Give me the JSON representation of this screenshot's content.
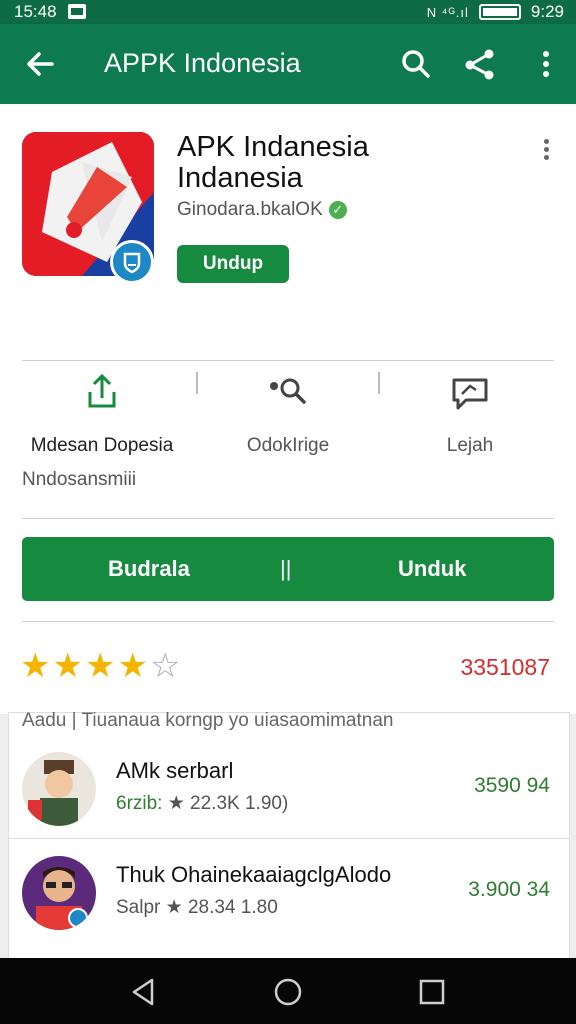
{
  "status_bar": {
    "left_time": "15:48",
    "right_time": "9:29",
    "signal_text": "N ⁴ᴳ.ıl"
  },
  "toolbar": {
    "title": "APPK Indonesia",
    "icons": [
      "back-arrow-icon",
      "search-icon",
      "share-icon",
      "more-vert-icon"
    ]
  },
  "app": {
    "name": "APK Indanesia Indanesia",
    "developer": "Ginodara.bkalOK",
    "verified_glyph": "✓",
    "install_small_label": "Undup"
  },
  "actions": [
    {
      "label": "Mdesan Dopesia",
      "icon": "share-upload-icon"
    },
    {
      "label": "OdokIrige",
      "icon": "search-person-icon"
    },
    {
      "label": "Lejah",
      "icon": "message-icon"
    }
  ],
  "sub_label": "Nndosansmiii",
  "big_button": {
    "left_label": "Budrala",
    "mid_label": "||",
    "right_label": "Unduk"
  },
  "rating": {
    "stars_filled": 4,
    "stars_total": 5,
    "count": "3351087",
    "star_color": "#f4b400"
  },
  "list": {
    "header": "Aadu   |   Tiuanaua korngp  yo uiasaomimatnan",
    "rows": [
      {
        "name": "AMk serbarl",
        "meta_prefix": "6rzib:",
        "meta_rest": "★ 22.3K 1.90)",
        "price": "3590 94"
      },
      {
        "name": "Thuk OhainekaaiagclgAlodo",
        "meta_prefix": "Salpr",
        "meta_rest": "★ 28.34 1.80",
        "price": "3.900 34"
      }
    ]
  },
  "colors": {
    "primary": "#0d7a50",
    "button_green": "#168a3e",
    "rating_red": "#d32f2f"
  }
}
